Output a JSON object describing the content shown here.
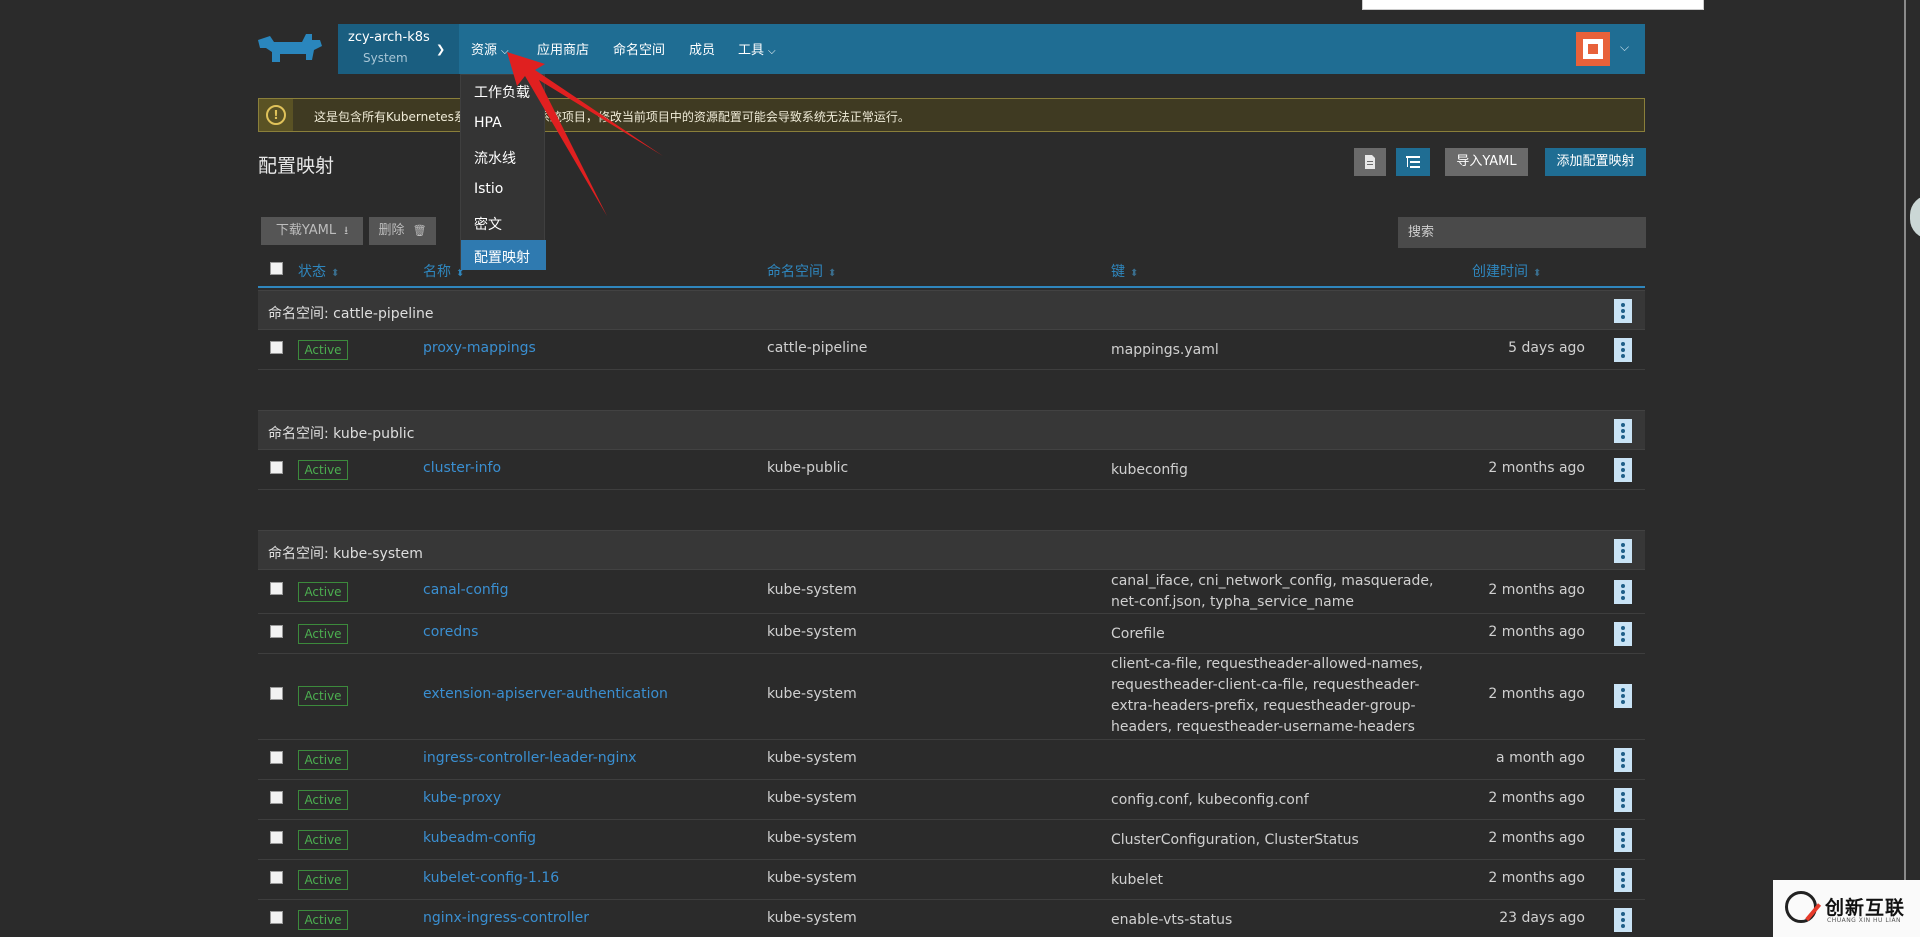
{
  "navbar": {
    "cluster_name": "zcy-arch-k8s",
    "project_name": "System",
    "items": [
      {
        "label": "资源",
        "has_caret": true
      },
      {
        "label": "应用商店",
        "has_caret": false
      },
      {
        "label": "命名空间",
        "has_caret": false
      },
      {
        "label": "成员",
        "has_caret": false
      },
      {
        "label": "工具",
        "has_caret": true
      }
    ]
  },
  "banner": {
    "text": "这是包含所有Kubernetes系统命名空间的系统项目，修改当前项目中的资源配置可能会导致系统无法正常运行。"
  },
  "dropdown": {
    "items": [
      {
        "label": "工作负载",
        "active": false
      },
      {
        "label": "HPA",
        "active": false
      },
      {
        "label": "流水线",
        "active": false
      },
      {
        "label": "Istio",
        "active": false
      },
      {
        "label": "密文",
        "active": false
      },
      {
        "label": "配置映射",
        "active": true
      }
    ]
  },
  "page": {
    "title": "配置映射",
    "import_label": "导入YAML",
    "add_label": "添加配置映射"
  },
  "bulk": {
    "download_label": "下载YAML",
    "delete_label": "删除"
  },
  "search": {
    "placeholder": "搜索"
  },
  "table": {
    "headers": [
      "状态",
      "名称",
      "命名空间",
      "键",
      "创建时间"
    ],
    "groups": [
      {
        "label": "命名空间: cattle-pipeline",
        "rows": [
          {
            "status": "Active",
            "name": "proxy-mappings",
            "namespace": "cattle-pipeline",
            "keys": "mappings.yaml",
            "created": "5 days ago"
          }
        ]
      },
      {
        "label": "命名空间: kube-public",
        "rows": [
          {
            "status": "Active",
            "name": "cluster-info",
            "namespace": "kube-public",
            "keys": "kubeconfig",
            "created": "2 months ago"
          }
        ]
      },
      {
        "label": "命名空间: kube-system",
        "rows": [
          {
            "status": "Active",
            "name": "canal-config",
            "namespace": "kube-system",
            "keys": "canal_iface, cni_network_config, masquerade, net-conf.json, typha_service_name",
            "created": "2 months ago"
          },
          {
            "status": "Active",
            "name": "coredns",
            "namespace": "kube-system",
            "keys": "Corefile",
            "created": "2 months ago"
          },
          {
            "status": "Active",
            "name": "extension-apiserver-authentication",
            "namespace": "kube-system",
            "keys": "client-ca-file, requestheader-allowed-names, requestheader-client-ca-file, requestheader-extra-headers-prefix, requestheader-group-headers, requestheader-username-headers",
            "created": "2 months ago"
          },
          {
            "status": "Active",
            "name": "ingress-controller-leader-nginx",
            "namespace": "kube-system",
            "keys": "",
            "created": "a month ago"
          },
          {
            "status": "Active",
            "name": "kube-proxy",
            "namespace": "kube-system",
            "keys": "config.conf, kubeconfig.conf",
            "created": "2 months ago"
          },
          {
            "status": "Active",
            "name": "kubeadm-config",
            "namespace": "kube-system",
            "keys": "ClusterConfiguration, ClusterStatus",
            "created": "2 months ago"
          },
          {
            "status": "Active",
            "name": "kubelet-config-1.16",
            "namespace": "kube-system",
            "keys": "kubelet",
            "created": "2 months ago"
          },
          {
            "status": "Active",
            "name": "nginx-ingress-controller",
            "namespace": "kube-system",
            "keys": "enable-vts-status",
            "created": "23 days ago"
          }
        ]
      }
    ]
  },
  "watermark": {
    "text": "创新互联",
    "subtext": "CHUANG XIN HU LIAN"
  },
  "colors": {
    "navbar": "#1f6d93",
    "link": "#3a8fd1",
    "active_badge": "#4caf50",
    "arrow": "#e02020",
    "avatar": "#e8613a"
  }
}
